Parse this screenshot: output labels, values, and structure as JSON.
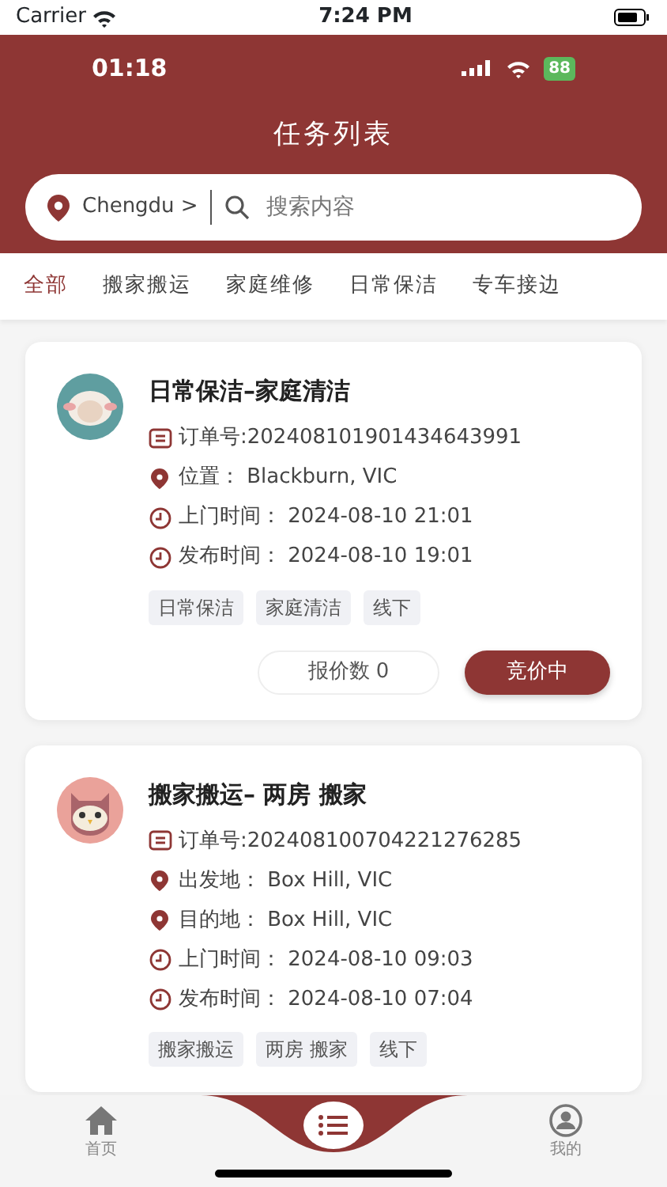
{
  "device_status": {
    "carrier": "Carrier",
    "time": "7:24 PM"
  },
  "app_status": {
    "time": "01:18",
    "battery": "88"
  },
  "header": {
    "title": "任务列表"
  },
  "search": {
    "city": "Chengdu >",
    "placeholder": "搜索内容"
  },
  "tabs": [
    {
      "label": "全部",
      "selected": true
    },
    {
      "label": "搬家搬运",
      "selected": false
    },
    {
      "label": "家庭维修",
      "selected": false
    },
    {
      "label": "日常保洁",
      "selected": false
    },
    {
      "label": "专车接边",
      "selected": false
    }
  ],
  "tasks": [
    {
      "kind": "sheep",
      "title": "日常保洁–家庭清洁",
      "rows": [
        {
          "kind": "order",
          "text": "订单号:202408101901434643991"
        },
        {
          "kind": "location",
          "text": "位置： Blackburn, VIC"
        },
        {
          "kind": "time",
          "text": "上门时间： 2024-08-10 21:01"
        },
        {
          "kind": "time",
          "text": "发布时间： 2024-08-10 19:01"
        }
      ],
      "tags": [
        "日常保洁",
        "家庭清洁",
        "线下"
      ],
      "quote_count": "报价数 0",
      "status_button": "竞价中"
    },
    {
      "kind": "owl",
      "title": "搬家搬运– 两房 搬家",
      "rows": [
        {
          "kind": "order",
          "text": "订单号:202408100704221276285"
        },
        {
          "kind": "location",
          "text": "出发地： Box Hill, VIC"
        },
        {
          "kind": "location",
          "text": "目的地： Box Hill, VIC"
        },
        {
          "kind": "time",
          "text": "上门时间： 2024-08-10 09:03"
        },
        {
          "kind": "time",
          "text": "发布时间： 2024-08-10 07:04"
        }
      ],
      "tags": [
        "搬家搬运",
        "两房 搬家",
        "线下"
      ]
    }
  ],
  "bottom_nav": [
    {
      "kind": "home",
      "label": "首页"
    },
    {
      "kind": "center"
    },
    {
      "kind": "profile",
      "label": "我的"
    }
  ]
}
